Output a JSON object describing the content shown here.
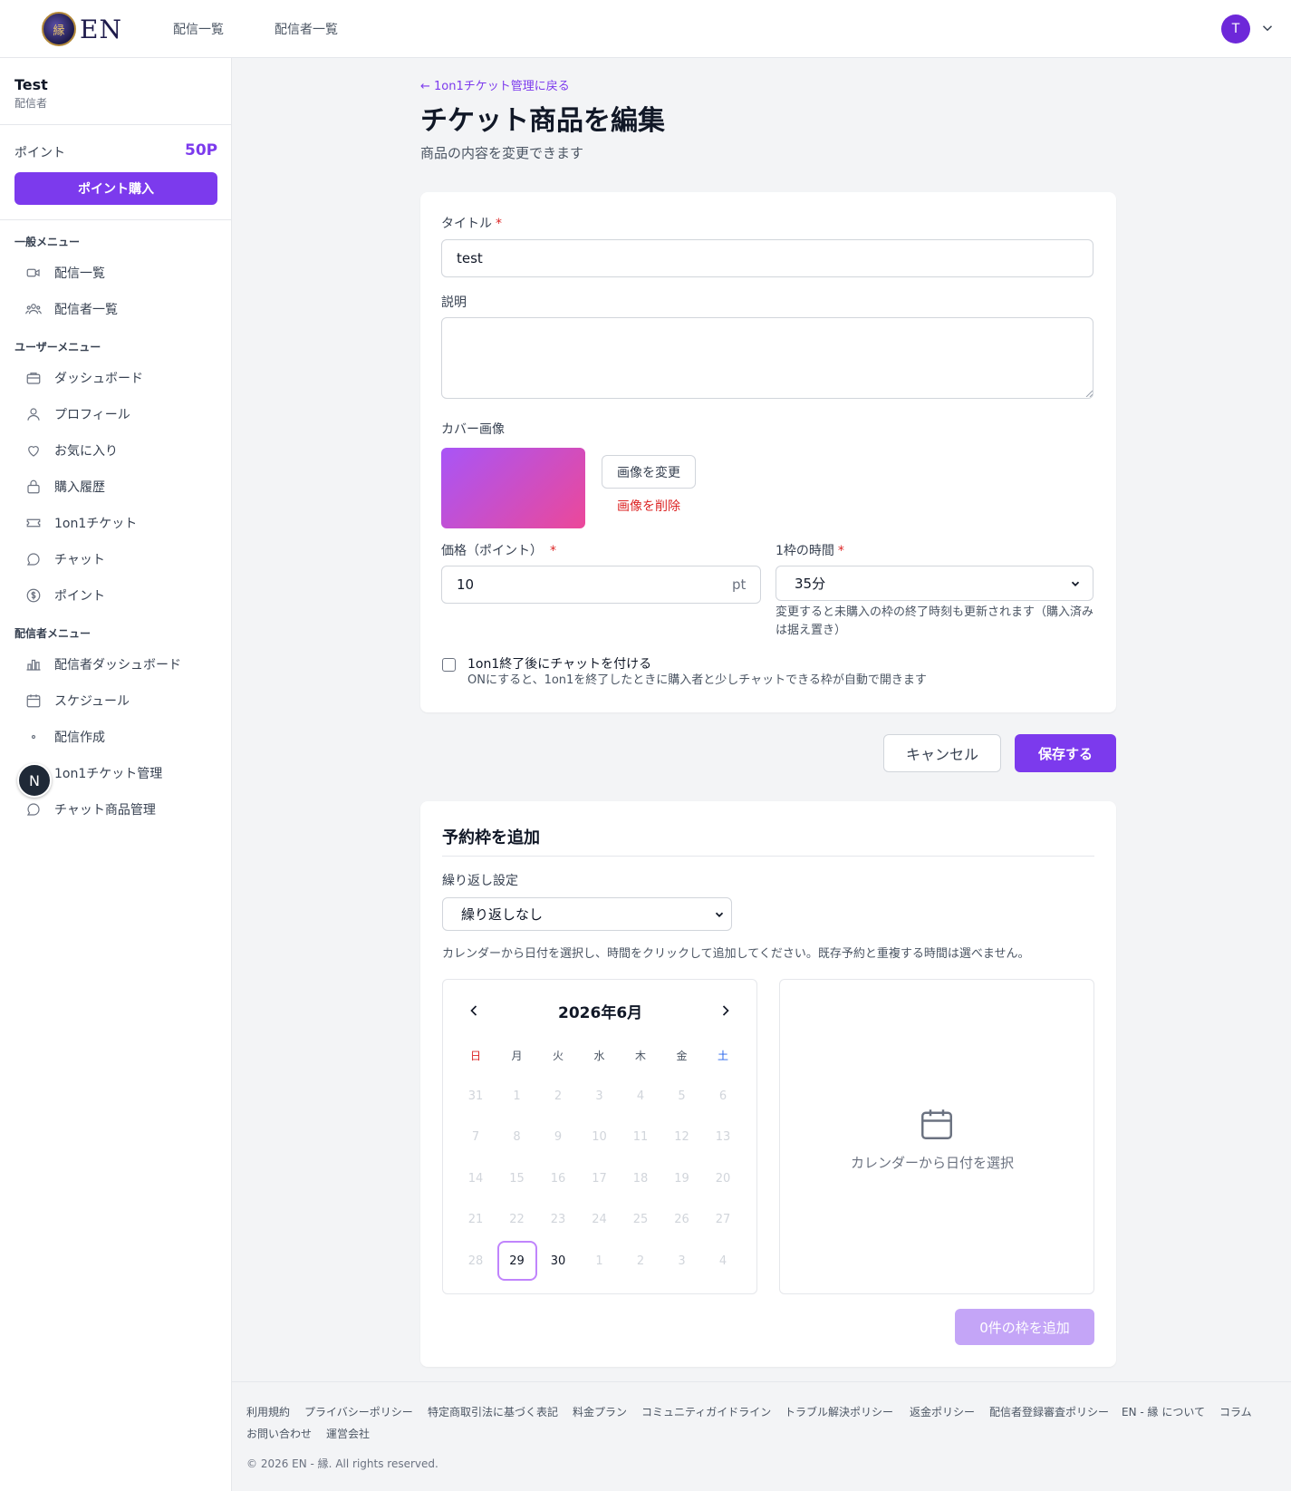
{
  "header": {
    "logo_text": "EN",
    "logo_mark": "縁",
    "nav": [
      "配信一覧",
      "配信者一覧"
    ],
    "avatar_initial": "T"
  },
  "sidebar": {
    "user_name": "Test",
    "user_role": "配信者",
    "points_label": "ポイント",
    "points_value": "50P",
    "buy_label": "ポイント購入",
    "sections": [
      {
        "title": "一般メニュー",
        "items": [
          {
            "label": "配信一覧",
            "icon": "video-icon"
          },
          {
            "label": "配信者一覧",
            "icon": "users-icon"
          }
        ]
      },
      {
        "title": "ユーザーメニュー",
        "items": [
          {
            "label": "ダッシュボード",
            "icon": "briefcase-icon"
          },
          {
            "label": "プロフィール",
            "icon": "user-icon"
          },
          {
            "label": "お気に入り",
            "icon": "heart-icon"
          },
          {
            "label": "購入履歴",
            "icon": "bag-icon"
          },
          {
            "label": "1on1チケット",
            "icon": "ticket-icon"
          },
          {
            "label": "チャット",
            "icon": "chat-icon"
          },
          {
            "label": "ポイント",
            "icon": "coin-icon"
          }
        ]
      },
      {
        "title": "配信者メニュー",
        "items": [
          {
            "label": "配信者ダッシュボード",
            "icon": "chart-icon"
          },
          {
            "label": "スケジュール",
            "icon": "calendar-icon"
          },
          {
            "label": "配信作成",
            "icon": "dot-icon"
          },
          {
            "label": "1on1チケット管理",
            "icon": "ticket-icon"
          },
          {
            "label": "チャット商品管理",
            "icon": "chat-icon"
          }
        ]
      }
    ],
    "floating_badge": "N"
  },
  "main": {
    "back_link": "← 1on1チケット管理に戻る",
    "title": "チケット商品を編集",
    "subtitle": "商品の内容を変更できます",
    "form": {
      "title_label": "タイトル",
      "title_value": "test",
      "desc_label": "説明",
      "desc_value": "",
      "cover_label": "カバー画像",
      "change_image": "画像を変更",
      "delete_image": "画像を削除",
      "price_label": "価格（ポイント）",
      "price_value": "10",
      "price_unit": "pt",
      "duration_label": "1枠の時間",
      "duration_value": "35分",
      "duration_hint": "変更すると未購入の枠の終了時刻も更新されます（購入済みは据え置き）",
      "chat_checkbox_label": "1on1終了後にチャットを付ける",
      "chat_checkbox_hint": "ONにすると、1on1を終了したときに購入者と少しチャットできる枠が自動で開きます",
      "chat_checked": false,
      "required_mark": "*"
    },
    "cancel_label": "キャンセル",
    "save_label": "保存する",
    "slots": {
      "title": "予約枠を追加",
      "repeat_label": "繰り返し設定",
      "repeat_value": "繰り返しなし",
      "instruction": "カレンダーから日付を選択し、時間をクリックして追加してください。既存予約と重複する時間は選べません。",
      "calendar": {
        "month_label": "2026年6月",
        "weekdays": [
          "日",
          "月",
          "火",
          "水",
          "木",
          "金",
          "土"
        ],
        "weeks": [
          [
            "31",
            "1",
            "2",
            "3",
            "4",
            "5",
            "6"
          ],
          [
            "7",
            "8",
            "9",
            "10",
            "11",
            "12",
            "13"
          ],
          [
            "14",
            "15",
            "16",
            "17",
            "18",
            "19",
            "20"
          ],
          [
            "21",
            "22",
            "23",
            "24",
            "25",
            "26",
            "27"
          ],
          [
            "28",
            "29",
            "30",
            "1",
            "2",
            "3",
            "4"
          ]
        ],
        "selected_day": "29",
        "enabled_days": [
          "29",
          "30"
        ]
      },
      "empty_text": "カレンダーから日付を選択",
      "add_button": "0件の枠を追加"
    }
  },
  "footer": {
    "links_row1": [
      "利用規約",
      "プライバシーポリシー",
      "特定商取引法に基づく表記",
      "料金プラン",
      "コミュニティガイドライン",
      "トラブル解決ポリシー",
      "返金ポリシー",
      "配信者登録審査ポリシー",
      "EN - 縁 について",
      "コラム"
    ],
    "links_row2": [
      "お問い合わせ",
      "運営会社"
    ],
    "copyright": "© 2026 EN - 縁. All rights reserved."
  },
  "colors": {
    "accent": "#7c3aed",
    "danger": "#dc2626",
    "sunday": "#dc2626",
    "saturday": "#2563eb"
  }
}
